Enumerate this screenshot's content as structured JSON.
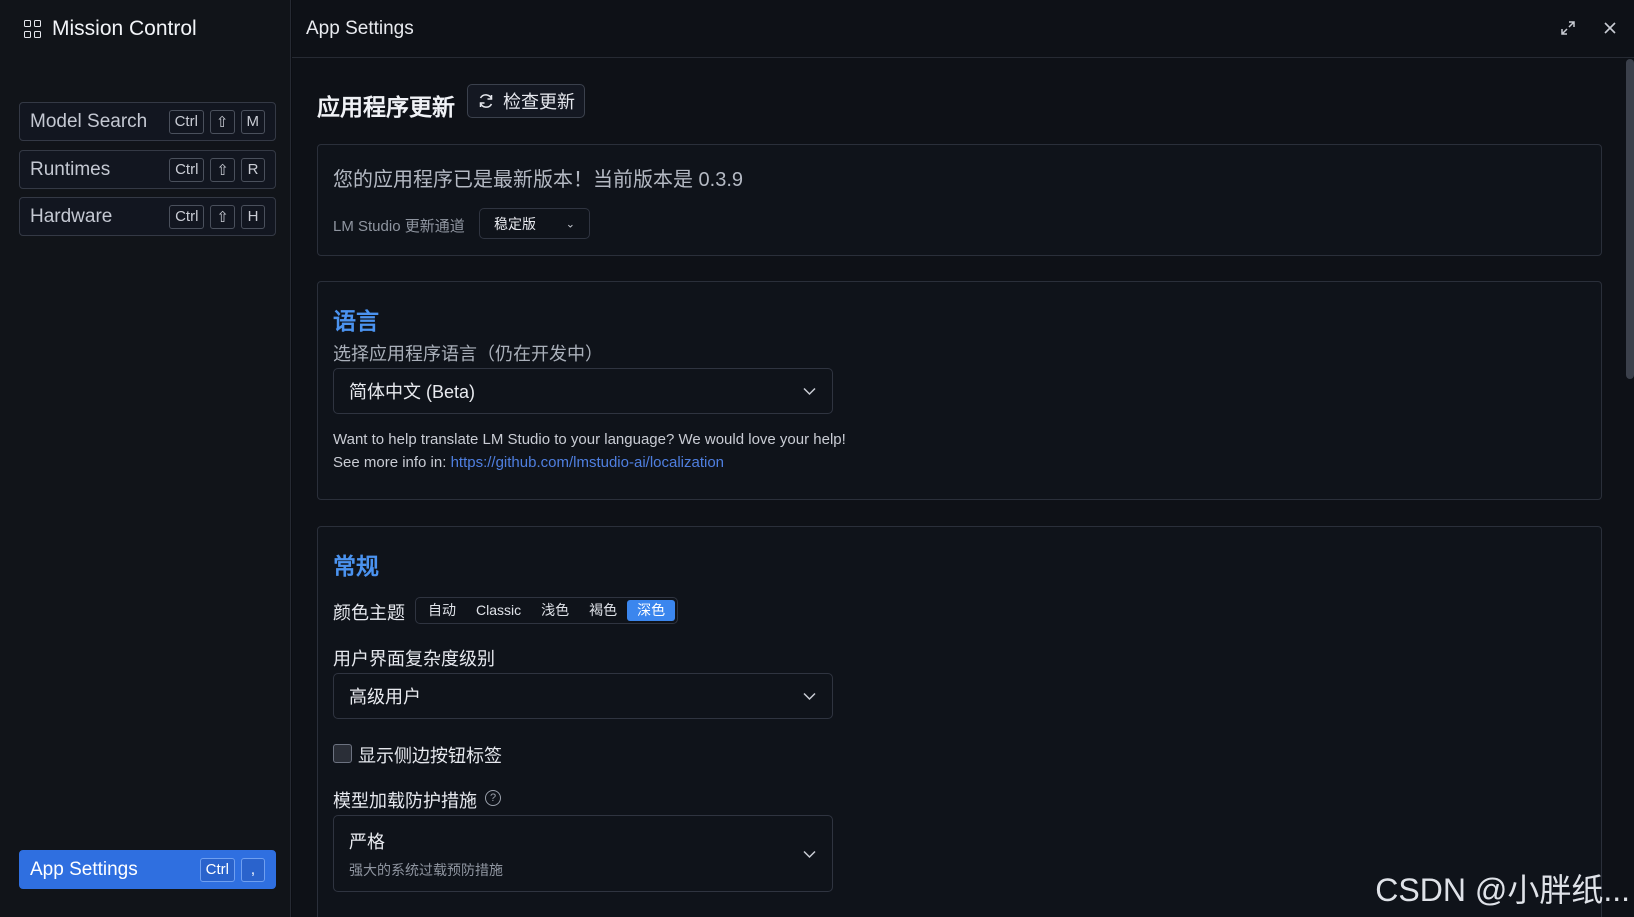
{
  "sidebar": {
    "brand": "Mission Control",
    "items": [
      {
        "label": "Model Search",
        "keys": [
          "Ctrl",
          "⇧",
          "M"
        ]
      },
      {
        "label": "Runtimes",
        "keys": [
          "Ctrl",
          "⇧",
          "R"
        ]
      },
      {
        "label": "Hardware",
        "keys": [
          "Ctrl",
          "⇧",
          "H"
        ]
      }
    ],
    "active_item": {
      "label": "App Settings",
      "keys": [
        "Ctrl",
        ","
      ]
    }
  },
  "window": {
    "title": "App Settings",
    "expand_icon": "expand-icon",
    "close_icon": "close-icon"
  },
  "update": {
    "heading": "应用程序更新",
    "check_button": "检查更新",
    "status": "您的应用程序已是最新版本！当前版本是 0.3.9",
    "channel_label": "LM Studio 更新通道",
    "channel_value": "稳定版"
  },
  "language": {
    "heading": "语言",
    "subtitle": "选择应用程序语言（仍在开发中）",
    "selected": "简体中文 (Beta)",
    "help_line1": "Want to help translate LM Studio to your language? We would love your help!",
    "help_line2_prefix": "See more info in: ",
    "help_link": "https://github.com/lmstudio-ai/localization"
  },
  "general": {
    "heading": "常规",
    "theme_label": "颜色主题",
    "theme_options": [
      "自动",
      "Classic",
      "浅色",
      "褐色",
      "深色"
    ],
    "theme_selected": "深色",
    "ui_level_label": "用户界面复杂度级别",
    "ui_level_value": "高级用户",
    "sidebar_labels_checkbox": "显示侧边按钮标签",
    "sidebar_labels_checked": false,
    "guardrails_label": "模型加载防护措施",
    "guardrails_value": "严格",
    "guardrails_desc": "强大的系统过载预防措施"
  },
  "watermark": "CSDN @小胖纸..."
}
